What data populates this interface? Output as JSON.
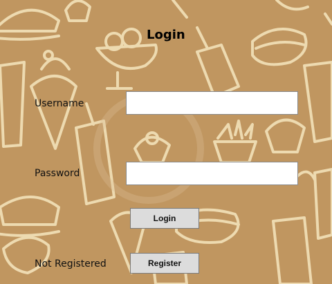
{
  "window": {
    "title": "Login"
  },
  "form": {
    "username_label": "Username",
    "username_value": "",
    "password_label": "Password",
    "password_value": "",
    "login_button": "Login",
    "not_registered_label": "Not Registered",
    "register_button": "Register"
  },
  "background": {
    "description_icon": "fast-food-pattern",
    "color": "#c09660",
    "line_color": "#f6e6bf"
  }
}
